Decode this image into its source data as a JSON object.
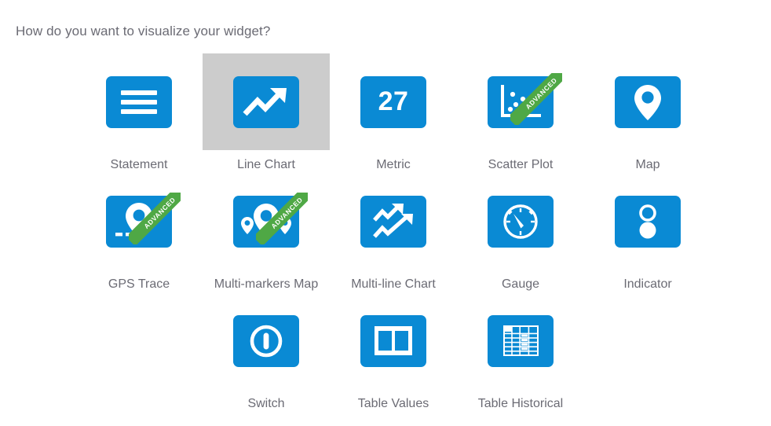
{
  "page": {
    "question": "How do you want to visualize your widget?",
    "accent_color": "#0a8ad4",
    "selected_color": "#cccccc",
    "ribbon_color": "#4fa845",
    "text_color": "#6b6b74",
    "background": "#ffffff"
  },
  "badges": {
    "advanced": "ADVANCED"
  },
  "metric": {
    "value": "27"
  },
  "rows": [
    {
      "items": [
        {
          "label": "Statement",
          "icon": "statement-icon",
          "selected": false,
          "advanced": false
        },
        {
          "label": "Line Chart",
          "icon": "line-chart-icon",
          "selected": true,
          "advanced": false
        },
        {
          "label": "Metric",
          "icon": "metric-icon",
          "selected": false,
          "advanced": false
        },
        {
          "label": "Scatter Plot",
          "icon": "scatter-plot-icon",
          "selected": false,
          "advanced": true
        },
        {
          "label": "Map",
          "icon": "map-pin-icon",
          "selected": false,
          "advanced": false
        }
      ]
    },
    {
      "items": [
        {
          "label": "GPS Trace",
          "icon": "gps-trace-icon",
          "selected": false,
          "advanced": true
        },
        {
          "label": "Multi-markers Map",
          "icon": "multi-markers-map-icon",
          "selected": false,
          "advanced": true
        },
        {
          "label": "Multi-line Chart",
          "icon": "multi-line-chart-icon",
          "selected": false,
          "advanced": false
        },
        {
          "label": "Gauge",
          "icon": "gauge-icon",
          "selected": false,
          "advanced": false
        },
        {
          "label": "Indicator",
          "icon": "indicator-icon",
          "selected": false,
          "advanced": false
        }
      ]
    },
    {
      "items": [
        {
          "label": "Switch",
          "icon": "switch-icon",
          "selected": false,
          "advanced": false
        },
        {
          "label": "Table Values",
          "icon": "table-values-icon",
          "selected": false,
          "advanced": false
        },
        {
          "label": "Table Historical",
          "icon": "table-historical-icon",
          "selected": false,
          "advanced": false
        }
      ]
    }
  ]
}
